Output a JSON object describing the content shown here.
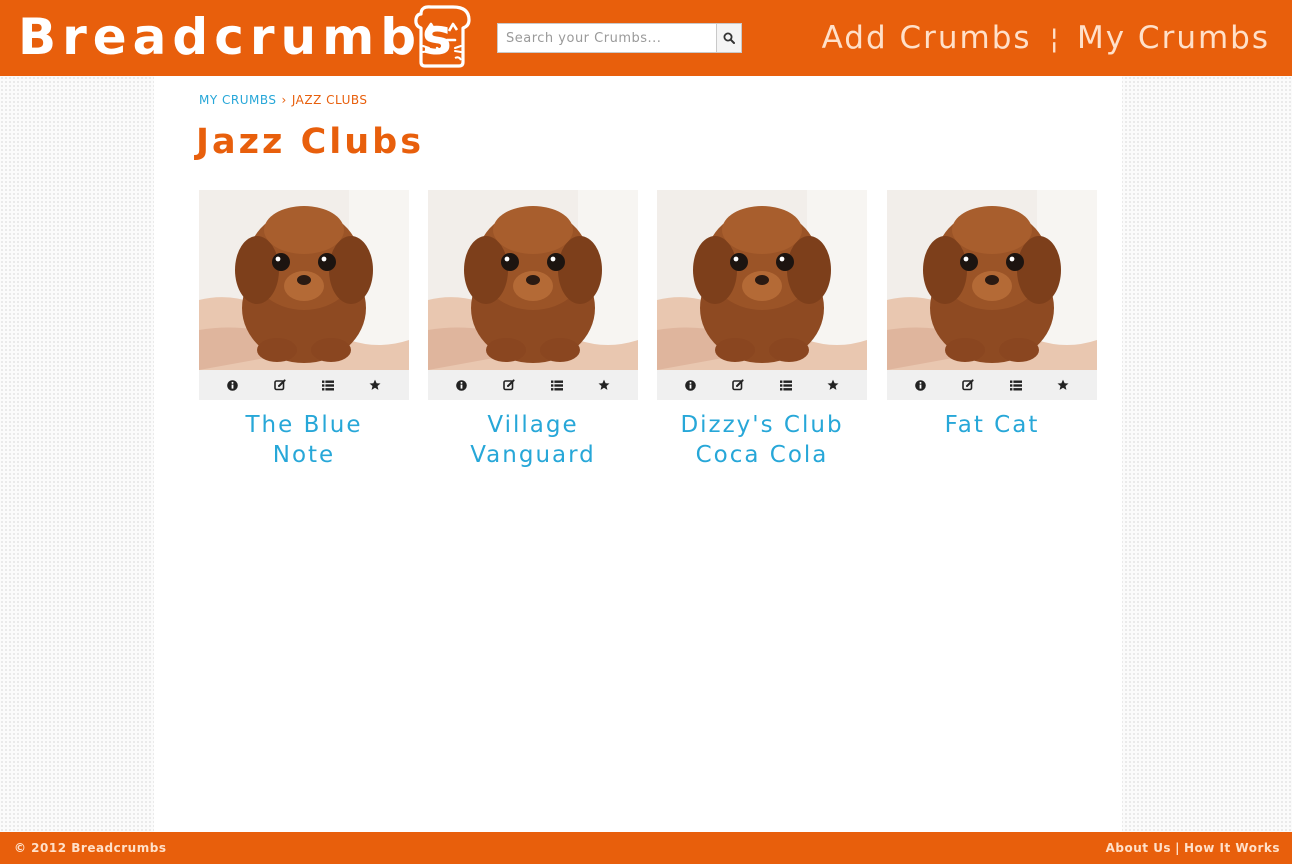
{
  "header": {
    "logo_text": "Breadcrumbs",
    "search": {
      "placeholder": "Search your Crumbs...",
      "value": ""
    },
    "nav": [
      {
        "label": "Add Crumbs"
      },
      {
        "label": "My Crumbs"
      }
    ],
    "nav_separator": "¦"
  },
  "breadcrumb": {
    "parent": "MY CRUMBS",
    "separator": "›",
    "current": "JAZZ CLUBS"
  },
  "page": {
    "title": "Jazz Clubs"
  },
  "cards": [
    {
      "title": "The Blue Note",
      "image": "puppy-photo",
      "actions": [
        "info-icon",
        "edit-icon",
        "list-icon",
        "star-icon"
      ]
    },
    {
      "title": "Village Vanguard",
      "image": "puppy-photo",
      "actions": [
        "info-icon",
        "edit-icon",
        "list-icon",
        "star-icon"
      ]
    },
    {
      "title": "Dizzy's Club Coca Cola",
      "image": "puppy-photo",
      "actions": [
        "info-icon",
        "edit-icon",
        "list-icon",
        "star-icon"
      ]
    },
    {
      "title": "Fat Cat",
      "image": "puppy-photo",
      "actions": [
        "info-icon",
        "edit-icon",
        "list-icon",
        "star-icon"
      ]
    }
  ],
  "footer": {
    "copyright": "© 2012 Breadcrumbs",
    "links": [
      {
        "label": "About Us"
      },
      {
        "label": "How It Works"
      }
    ],
    "separator": "|"
  },
  "colors": {
    "brand_orange": "#e85f0c",
    "link_blue": "#27a7d8",
    "header_text": "#ffffff",
    "nav_text": "#ffe0c9"
  }
}
